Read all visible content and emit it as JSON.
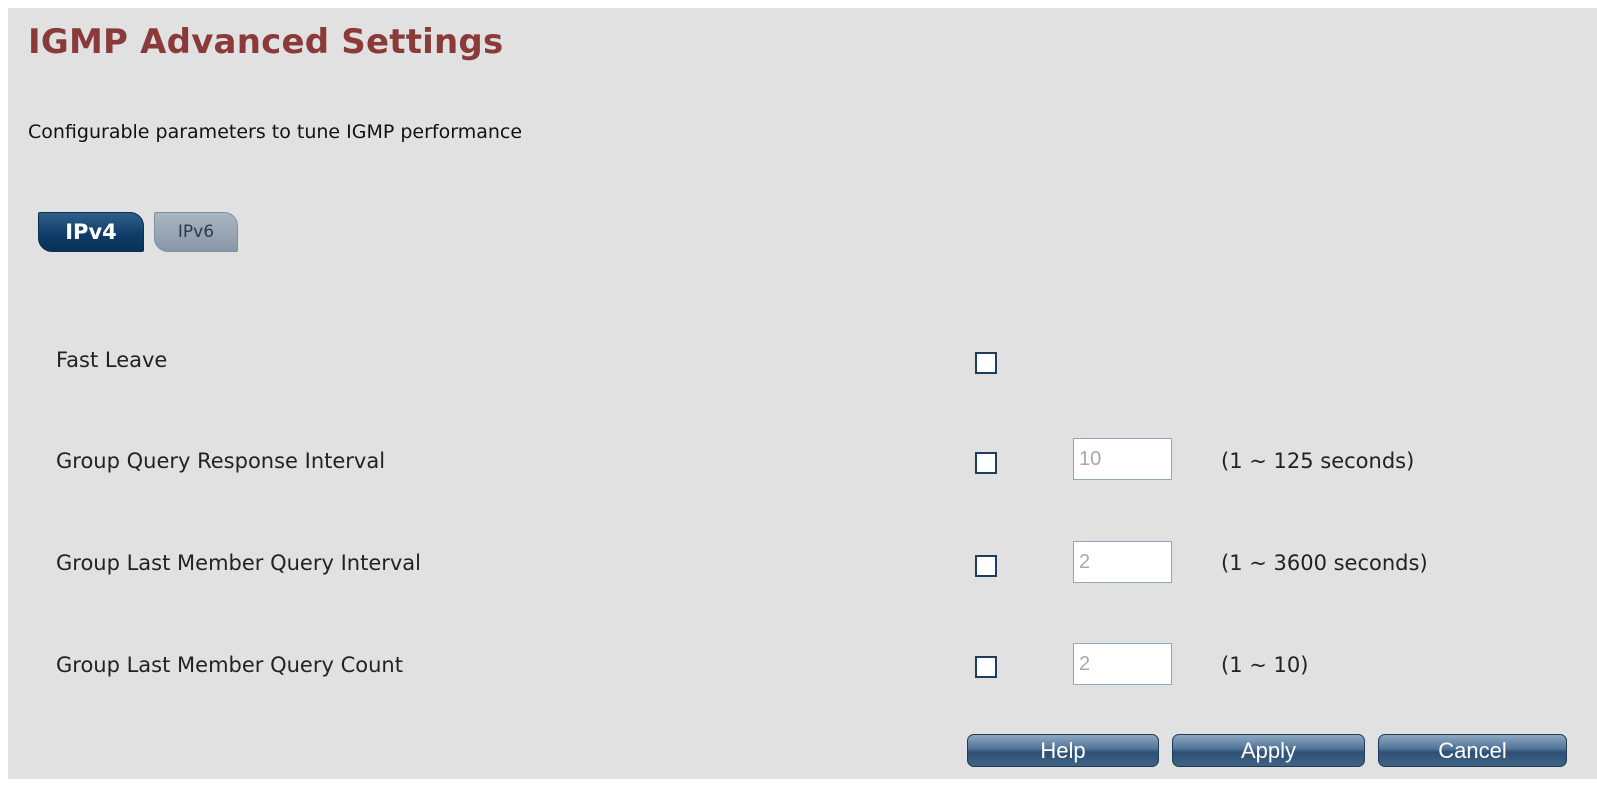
{
  "header": {
    "title": "IGMP Advanced Settings",
    "subtitle": "Configurable parameters to tune IGMP performance"
  },
  "tabs": [
    {
      "label": "IPv4",
      "active": true
    },
    {
      "label": "IPv6",
      "active": false
    }
  ],
  "settings": [
    {
      "label": "Fast Leave",
      "checked": false
    },
    {
      "label": "Group Query Response Interval",
      "checked": false,
      "value": "10",
      "range": "(1 ~ 125 seconds)"
    },
    {
      "label": "Group Last Member Query Interval",
      "checked": false,
      "value": "2",
      "range": "(1 ~ 3600 seconds)"
    },
    {
      "label": "Group Last Member Query Count",
      "checked": false,
      "value": "2",
      "range": "(1 ~ 10)"
    }
  ],
  "buttons": {
    "help": "Help",
    "apply": "Apply",
    "cancel": "Cancel"
  },
  "colors": {
    "title": "#8b3a3a",
    "panel_background": "#e1e1e1",
    "active_tab": "#0d3b66",
    "inactive_tab": "#8898a8",
    "button": "#3f6385"
  }
}
